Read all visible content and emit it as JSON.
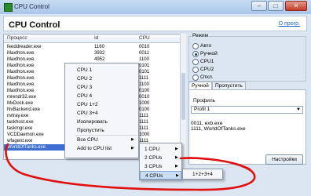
{
  "window": {
    "title": "CPU Control",
    "app_title": "CPU Control",
    "about_link": "О прогр."
  },
  "table": {
    "columns": [
      "Процесс",
      "Id",
      "CPU"
    ],
    "rows": [
      {
        "name": "feeddreader.exe",
        "id": "1160",
        "cpu": "0010"
      },
      {
        "name": "Maxthon.exe",
        "id": "3932",
        "cpu": "0011"
      },
      {
        "name": "Maxthon.exe",
        "id": "4952",
        "cpu": "1100"
      },
      {
        "name": "Maxthon.exe",
        "id": "",
        "cpu": "0101"
      },
      {
        "name": "Maxthon.exe",
        "id": "",
        "cpu": "0101"
      },
      {
        "name": "Maxthon.exe",
        "id": "",
        "cpu": "1111"
      },
      {
        "name": "Maxthon.exe",
        "id": "",
        "cpu": "1100"
      },
      {
        "name": "Maxthon.exe",
        "id": "",
        "cpu": "0100"
      },
      {
        "name": "mrendr32.exe",
        "id": "",
        "cpu": "0010"
      },
      {
        "name": "MxDock.exe",
        "id": "",
        "cpu": "1000"
      },
      {
        "name": "NvBackend.exe",
        "id": "",
        "cpu": "0100"
      },
      {
        "name": "nvtray.exe",
        "id": "",
        "cpu": "1111"
      },
      {
        "name": "taskhost.exe",
        "id": "",
        "cpu": "1111"
      },
      {
        "name": "taskmgr.exe",
        "id": "",
        "cpu": "1111"
      },
      {
        "name": "VCDDaemon.exe",
        "id": "",
        "cpu": "1000"
      },
      {
        "name": "wfagent.exe",
        "id": "",
        "cpu": "1111"
      },
      {
        "name": "WorldOfTanks.exe",
        "id": "",
        "cpu": "1111"
      }
    ],
    "selected_index": 16
  },
  "mode": {
    "title": "Режим",
    "options": [
      {
        "label": "Авто",
        "checked": false
      },
      {
        "label": "Ручной",
        "checked": true
      },
      {
        "label": "CPU1",
        "checked": false
      },
      {
        "label": "CPU2",
        "checked": false
      },
      {
        "label": "Откл.",
        "checked": false
      }
    ]
  },
  "tabs": [
    {
      "label": "Ручной",
      "active": true
    },
    {
      "label": "Пропустить",
      "active": false
    }
  ],
  "profile": {
    "label": "Профиль",
    "value": "Profil 1",
    "lines": [
      "0011, exb.exe",
      "1111, WorldOfTanks.exe"
    ]
  },
  "settings_button": "Настройки",
  "context_menu": {
    "items": [
      "CPU 1",
      "CPU 2",
      "CPU 3",
      "CPU 4",
      "CPU 1+2",
      "CPU 3+4",
      "Изолировать",
      "Пропустить",
      "Все CPU",
      "Add to CPU list"
    ]
  },
  "submenu": {
    "items": [
      "1 CPU",
      "2 CPUs",
      "3 CPUs",
      "4 CPUs"
    ],
    "highlighted": 3
  },
  "submenu2": {
    "items": [
      "1+2+3+4"
    ]
  },
  "annotation_color": "#e01010"
}
